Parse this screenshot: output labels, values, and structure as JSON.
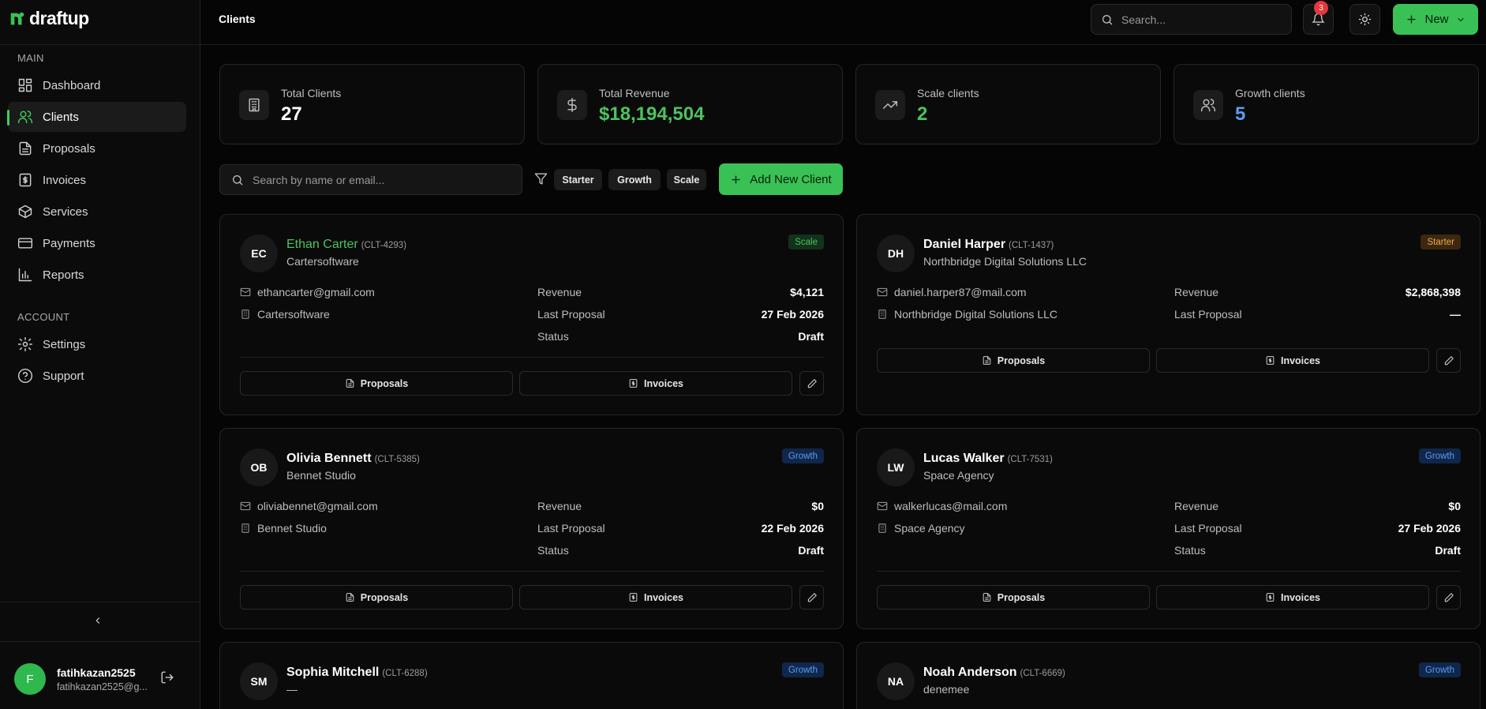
{
  "brand": {
    "name": "draftup",
    "accent": "#3ac155"
  },
  "sidebar": {
    "main_label": "MAIN",
    "account_label": "ACCOUNT",
    "items": [
      {
        "label": "Dashboard",
        "icon": "dashboard-icon"
      },
      {
        "label": "Clients",
        "icon": "users-icon",
        "active": true
      },
      {
        "label": "Proposals",
        "icon": "file-text-icon"
      },
      {
        "label": "Invoices",
        "icon": "receipt-icon"
      },
      {
        "label": "Services",
        "icon": "package-icon"
      },
      {
        "label": "Payments",
        "icon": "credit-card-icon"
      },
      {
        "label": "Reports",
        "icon": "bar-chart-icon"
      }
    ],
    "account_items": [
      {
        "label": "Settings",
        "icon": "gear-icon"
      },
      {
        "label": "Support",
        "icon": "help-circle-icon"
      }
    ],
    "user": {
      "initial": "F",
      "name": "fatihkazan2525",
      "email": "fatihkazan2525@g..."
    }
  },
  "topbar": {
    "title": "Clients",
    "search_placeholder": "Search...",
    "notifications_count": "3",
    "new_label": "New"
  },
  "stats": [
    {
      "label": "Total Clients",
      "value": "27",
      "color": "#ffffff",
      "icon": "building-icon"
    },
    {
      "label": "Total Revenue",
      "value": "$18,194,504",
      "color": "#4cc35f",
      "icon": "dollar-icon"
    },
    {
      "label": "Scale clients",
      "value": "2",
      "color": "#4cc35f",
      "icon": "trending-up-icon"
    },
    {
      "label": "Growth clients",
      "value": "5",
      "color": "#5b9cf5",
      "icon": "users-icon"
    }
  ],
  "filters": {
    "search_placeholder": "Search by name or email...",
    "chips": [
      "Starter",
      "Growth",
      "Scale"
    ],
    "add_label": "Add New Client"
  },
  "labels": {
    "revenue": "Revenue",
    "last_proposal": "Last Proposal",
    "status": "Status",
    "proposals": "Proposals",
    "invoices": "Invoices"
  },
  "clients": [
    {
      "initials": "EC",
      "name": "Ethan Carter",
      "id": "(CLT-4293)",
      "company": "Cartersoftware",
      "plan": "Scale",
      "email": "ethancarter@gmail.com",
      "org": "Cartersoftware",
      "revenue": "$4,121",
      "last_proposal": "27 Feb 2026",
      "status": "Draft"
    },
    {
      "initials": "DH",
      "name": "Daniel Harper",
      "id": "(CLT-1437)",
      "company": "Northbridge Digital Solutions LLC",
      "plan": "Starter",
      "email": "daniel.harper87@mail.com",
      "org": "Northbridge Digital Solutions LLC",
      "revenue": "$2,868,398",
      "last_proposal": "—",
      "status": ""
    },
    {
      "initials": "OB",
      "name": "Olivia Bennett",
      "id": "(CLT-5385)",
      "company": "Bennet Studio",
      "plan": "Growth",
      "email": "oliviabennet@gmail.com",
      "org": "Bennet Studio",
      "revenue": "$0",
      "last_proposal": "22 Feb 2026",
      "status": "Draft"
    },
    {
      "initials": "LW",
      "name": "Lucas Walker",
      "id": "(CLT-7531)",
      "company": "Space Agency",
      "plan": "Growth",
      "email": "walkerlucas@mail.com",
      "org": "Space Agency",
      "revenue": "$0",
      "last_proposal": "27 Feb 2026",
      "status": "Draft"
    },
    {
      "initials": "SM",
      "name": "Sophia Mitchell",
      "id": "(CLT-6288)",
      "company": "—",
      "plan": "Growth"
    },
    {
      "initials": "NA",
      "name": "Noah Anderson",
      "id": "(CLT-6669)",
      "company": "denemee",
      "plan": "Growth"
    }
  ]
}
